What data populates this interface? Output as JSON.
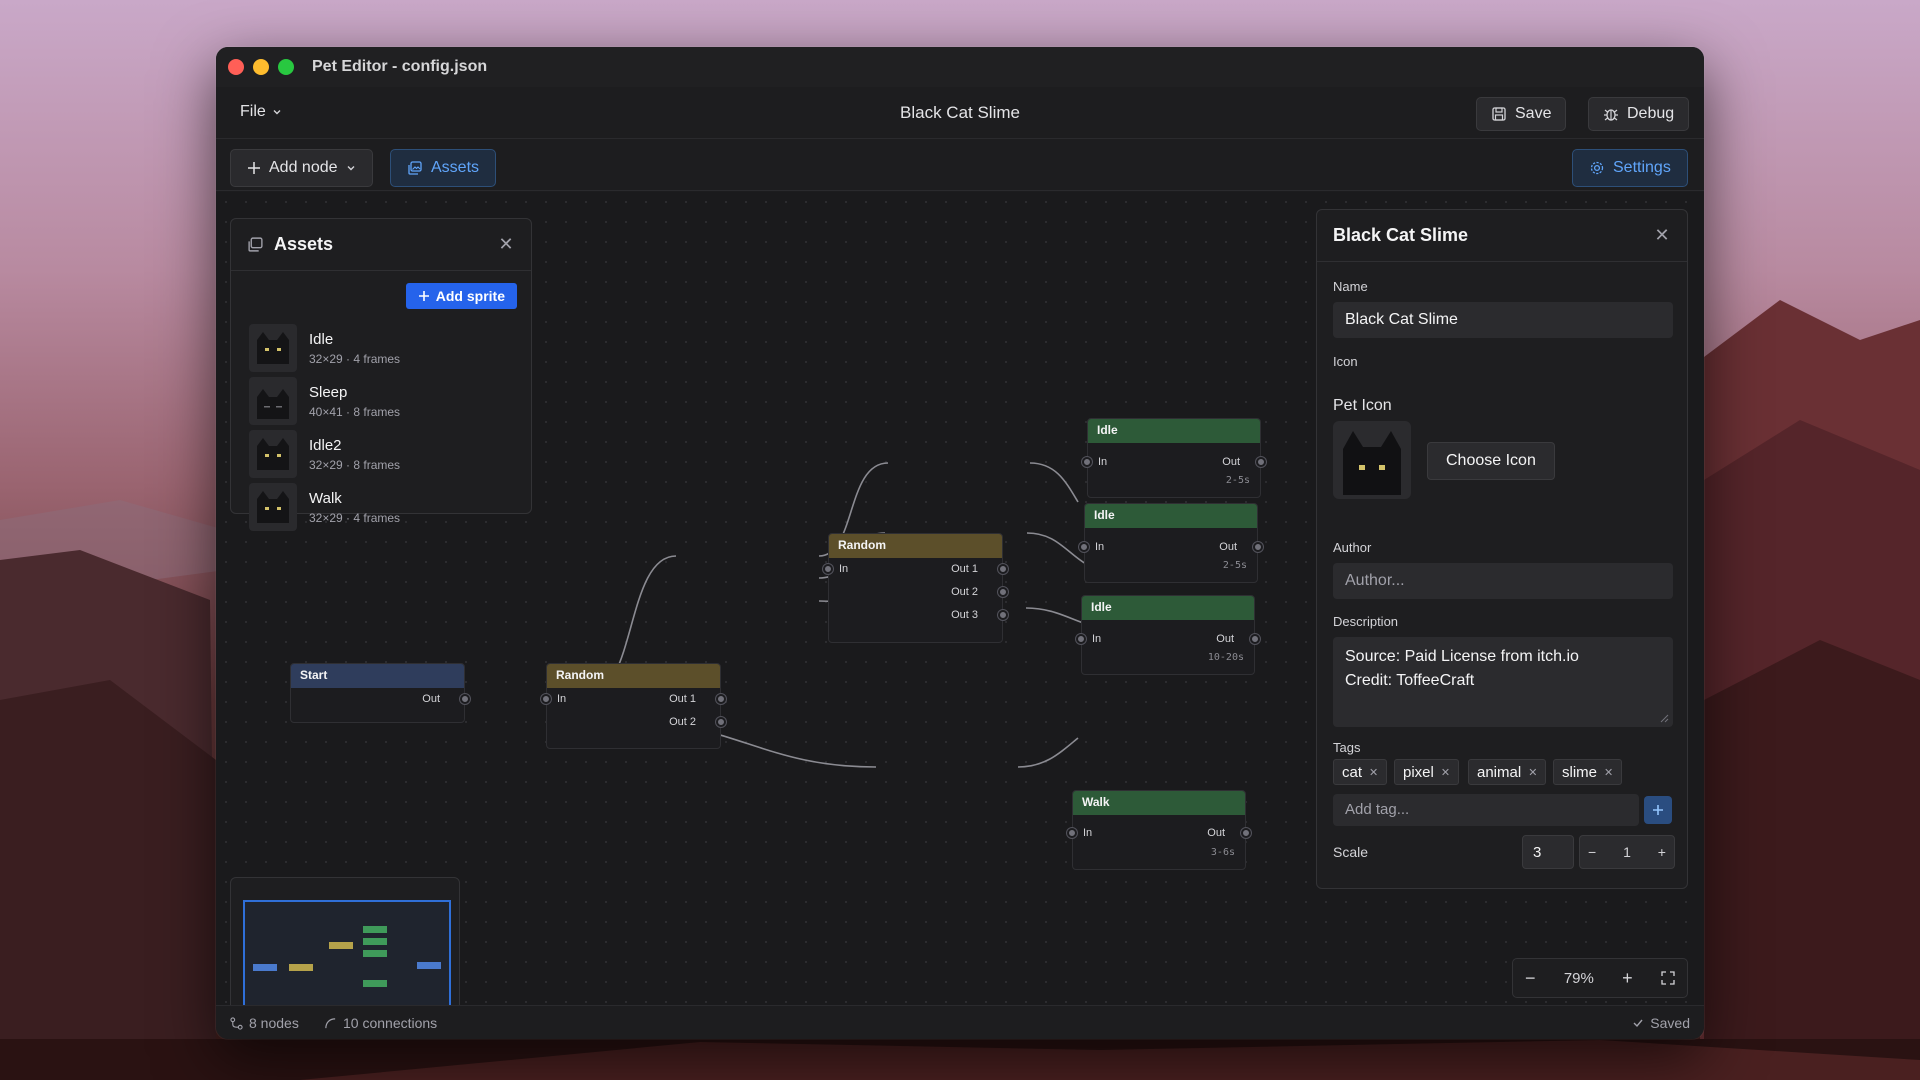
{
  "window": {
    "title": "Pet Editor - config.json"
  },
  "menubar": {
    "file_label": "File",
    "document_title": "Black Cat Slime",
    "save_label": "Save",
    "debug_label": "Debug"
  },
  "toolbar": {
    "add_node_label": "Add node",
    "assets_label": "Assets",
    "settings_label": "Settings"
  },
  "assets_panel": {
    "title": "Assets",
    "add_sprite_label": "Add sprite",
    "sprites": [
      {
        "name": "Idle",
        "meta": "32×29 · 4 frames"
      },
      {
        "name": "Sleep",
        "meta": "40×41 · 8 frames"
      },
      {
        "name": "Idle2",
        "meta": "32×29 · 8 frames"
      },
      {
        "name": "Walk",
        "meta": "32×29 · 4 frames"
      }
    ]
  },
  "nodes": {
    "start": {
      "title": "Start",
      "out": "Out"
    },
    "random1": {
      "title": "Random",
      "in": "In",
      "out1": "Out 1",
      "out2": "Out 2"
    },
    "random2": {
      "title": "Random",
      "in": "In",
      "out1": "Out 1",
      "out2": "Out 2",
      "out3": "Out 3"
    },
    "idle1": {
      "title": "Idle",
      "in": "In",
      "out": "Out",
      "duration": "2-5s"
    },
    "idle2": {
      "title": "Idle",
      "in": "In",
      "out": "Out",
      "duration": "2-5s"
    },
    "idle3": {
      "title": "Idle",
      "in": "In",
      "out": "Out",
      "duration": "10-20s"
    },
    "walk": {
      "title": "Walk",
      "in": "In",
      "out": "Out",
      "duration": "3-6s"
    }
  },
  "properties": {
    "title": "Black Cat Slime",
    "name_label": "Name",
    "name_value": "Black Cat Slime",
    "icon_label": "Icon",
    "pet_icon_label": "Pet Icon",
    "choose_icon_label": "Choose Icon",
    "author_label": "Author",
    "author_placeholder": "Author...",
    "description_label": "Description",
    "description_line1": "Source: Paid License from itch.io",
    "description_line2": "Credit: ToffeeCraft",
    "tags_label": "Tags",
    "tags": [
      "cat",
      "pixel",
      "animal",
      "slime"
    ],
    "add_tag_placeholder": "Add tag...",
    "scale_label": "Scale",
    "scale_value": "3",
    "scale_step": "1"
  },
  "zoom": {
    "level": "79%"
  },
  "status": {
    "nodes": "8 nodes",
    "connections": "10 connections",
    "saved": "Saved"
  },
  "colors": {
    "accent": "#2563eb",
    "node_start": "#2f3d5c",
    "node_random": "#5c4f2a",
    "node_action": "#2d5a38"
  }
}
